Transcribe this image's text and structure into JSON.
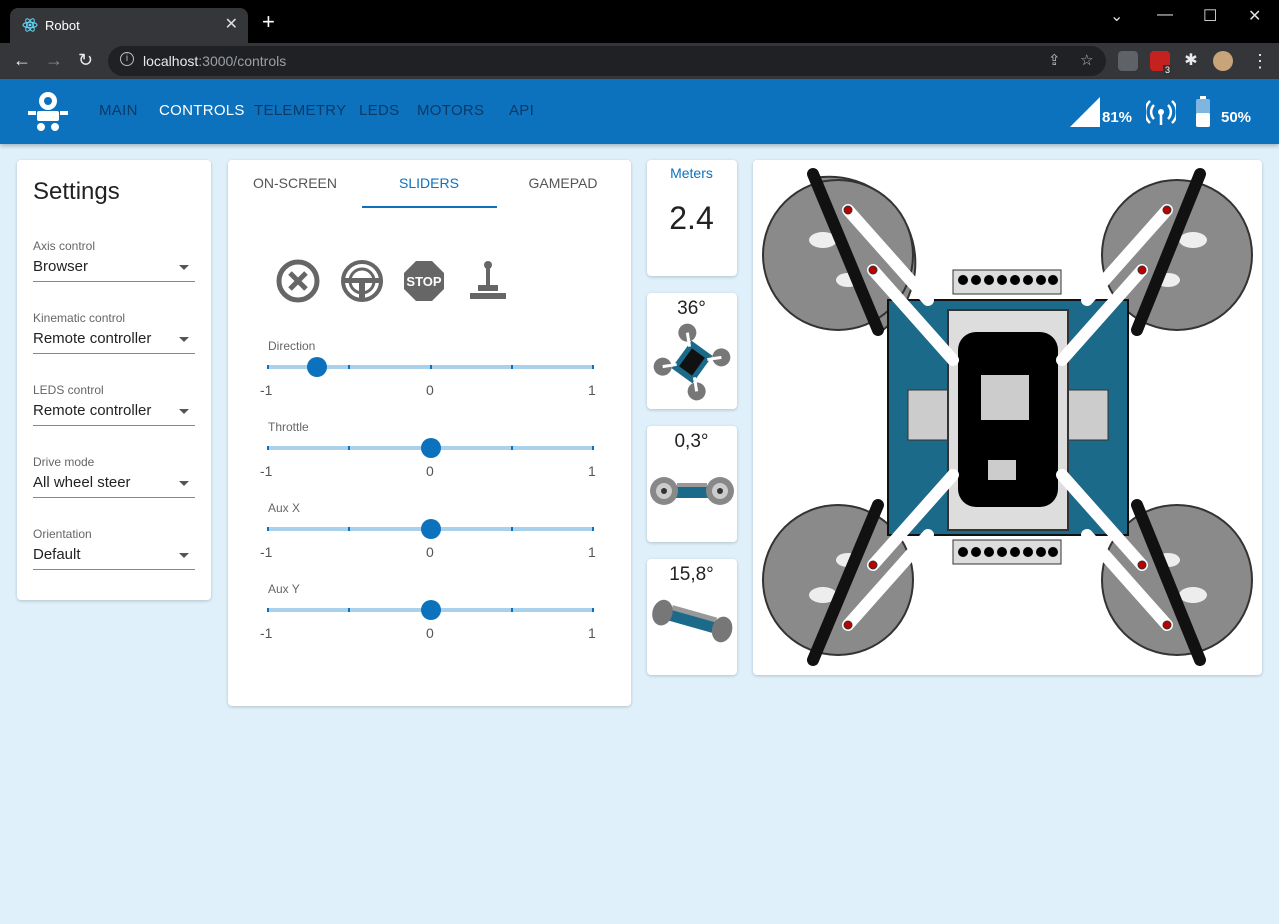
{
  "browser": {
    "tab_title": "Robot",
    "url_host": "localhost",
    "url_rest": ":3000/controls",
    "ext_badge": "3"
  },
  "nav": {
    "items": [
      {
        "label": "MAIN"
      },
      {
        "label": "CONTROLS"
      },
      {
        "label": "TELEMETRY"
      },
      {
        "label": "LEDS"
      },
      {
        "label": "MOTORS"
      },
      {
        "label": "API"
      }
    ],
    "active_index": 1
  },
  "status": {
    "signal": "81%",
    "battery": "50%"
  },
  "settings": {
    "title": "Settings",
    "fields": [
      {
        "label": "Axis control",
        "value": "Browser"
      },
      {
        "label": "Kinematic control",
        "value": "Remote controller"
      },
      {
        "label": "LEDS control",
        "value": "Remote controller"
      },
      {
        "label": "Drive mode",
        "value": "All wheel steer"
      },
      {
        "label": "Orientation",
        "value": "Default"
      }
    ]
  },
  "controls": {
    "tabs": [
      {
        "label": "ON-SCREEN"
      },
      {
        "label": "SLIDERS"
      },
      {
        "label": "GAMEPAD"
      }
    ],
    "active_tab": 1,
    "mode_icons": [
      "cancel-icon",
      "steering-wheel-icon",
      "stop-sign-icon",
      "joystick-icon"
    ],
    "stop_text": "STOP",
    "sliders": [
      {
        "label": "Direction",
        "value": -0.7,
        "min": "-1",
        "mid": "0",
        "max": "1"
      },
      {
        "label": "Throttle",
        "value": 0,
        "min": "-1",
        "mid": "0",
        "max": "1"
      },
      {
        "label": "Aux X",
        "value": 0,
        "min": "-1",
        "mid": "0",
        "max": "1"
      },
      {
        "label": "Aux Y",
        "value": 0,
        "min": "-1",
        "mid": "0",
        "max": "1"
      }
    ]
  },
  "meters": {
    "title": "Meters",
    "value": "2.4"
  },
  "angles": [
    {
      "value": "36°"
    },
    {
      "value": "0,3°"
    },
    {
      "value": "15,8°"
    }
  ],
  "colors": {
    "appbar": "#0c72bd",
    "background": "#dff0fb",
    "robot_frame": "#1c6a8a"
  }
}
